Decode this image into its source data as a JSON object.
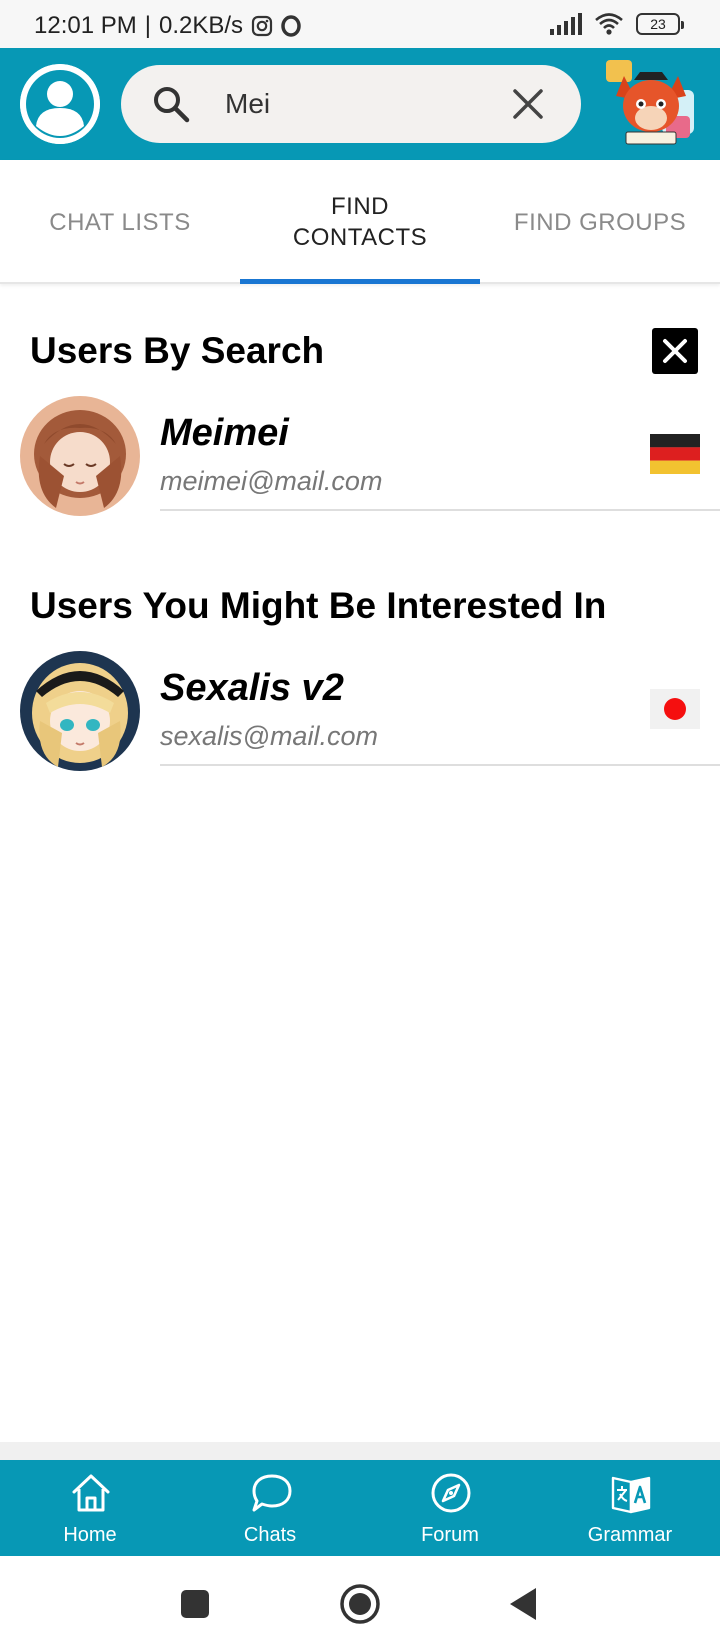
{
  "status_bar": {
    "time": "12:01 PM",
    "separator": "|",
    "network_speed": "0.2KB/s",
    "battery": "23",
    "icons": [
      "instagram-icon",
      "opera-icon",
      "signal-icon",
      "wifi-icon",
      "battery-icon"
    ]
  },
  "header": {
    "search_value": "Mei",
    "search_placeholder": "",
    "avatar_icon": "user-avatar-icon",
    "logo_icon": "fox-translate-logo"
  },
  "tabs": [
    {
      "label": "CHAT LISTS",
      "active": false
    },
    {
      "label": "FIND\nCONTACTS",
      "active": true
    },
    {
      "label": "FIND GROUPS",
      "active": false
    }
  ],
  "search_results": {
    "title": "Users By Search",
    "users": [
      {
        "name": "Meimei",
        "email": "meimei@mail.com",
        "flag": "germany"
      }
    ]
  },
  "suggestions": {
    "title": "Users You Might Be Interested In",
    "users": [
      {
        "name": "Sexalis v2",
        "email": "sexalis@mail.com",
        "flag": "japan"
      }
    ]
  },
  "bottom_nav": [
    {
      "label": "Home",
      "icon": "home-icon"
    },
    {
      "label": "Chats",
      "icon": "chat-bubble-icon"
    },
    {
      "label": "Forum",
      "icon": "compass-icon"
    },
    {
      "label": "Grammar",
      "icon": "translate-icon"
    }
  ],
  "colors": {
    "accent": "#0798b5",
    "tab_indicator": "#1976d2"
  }
}
